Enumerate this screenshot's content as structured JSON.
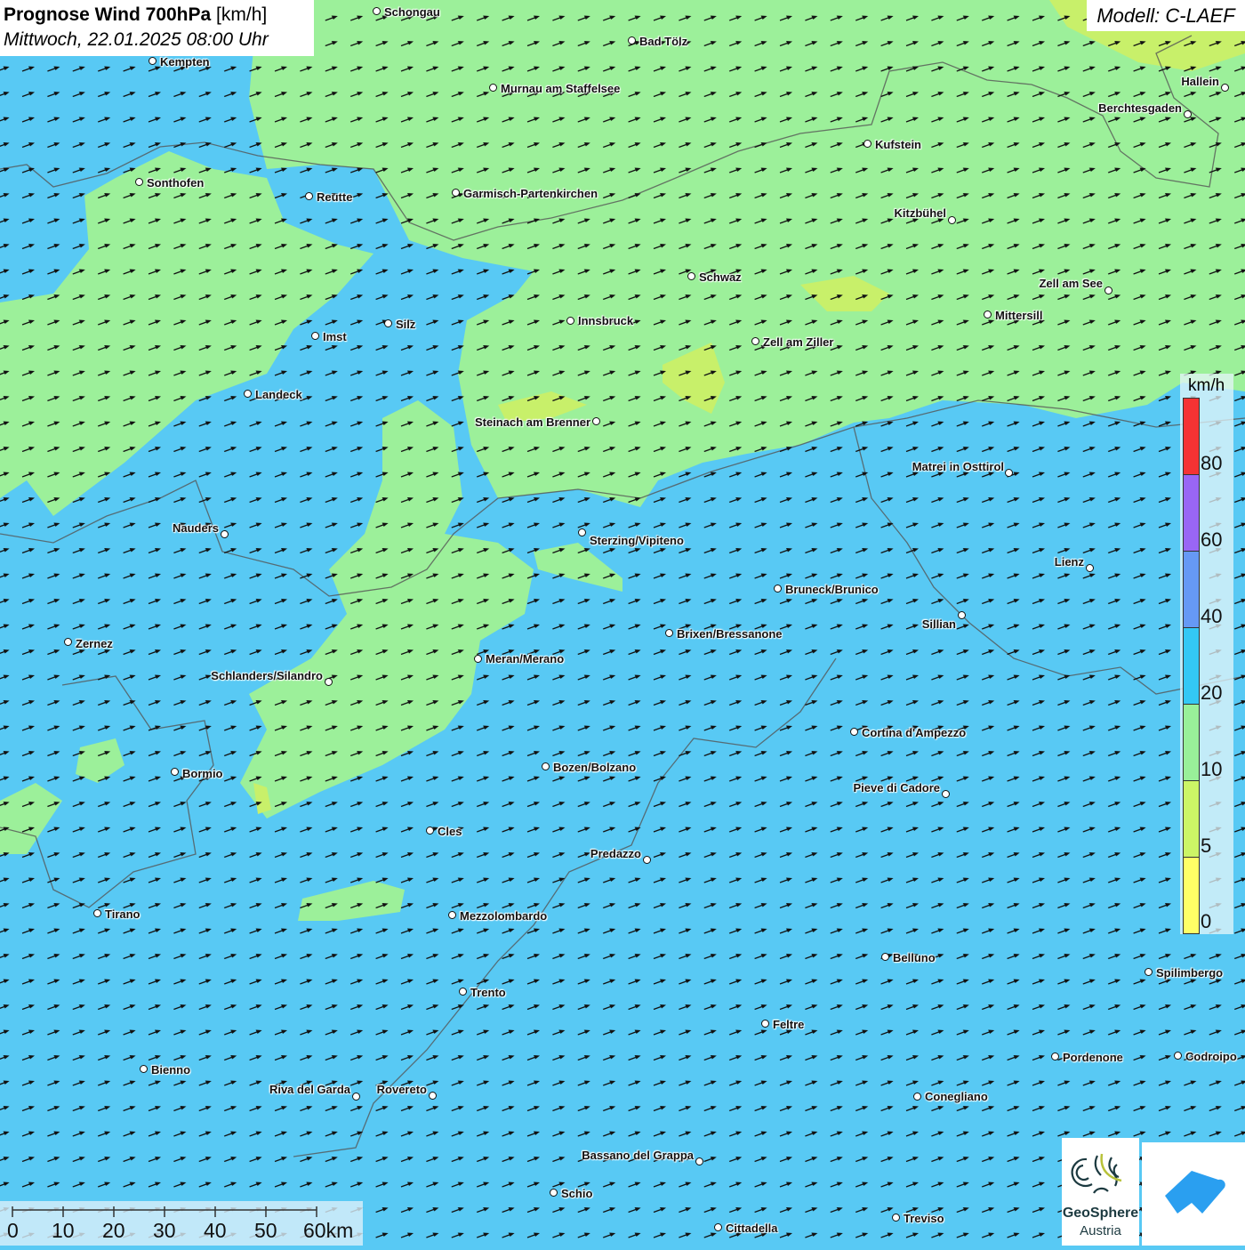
{
  "header": {
    "title_bold": "Prognose Wind 700hPa",
    "title_unit": "[km/h]",
    "subtitle": "Mittwoch, 22.01.2025 08:00 Uhr",
    "model": "Modell: C-LAEF"
  },
  "legend": {
    "unit": "km/h",
    "ticks": [
      "0",
      "5",
      "10",
      "20",
      "40",
      "60",
      "80"
    ],
    "colors": [
      "#ffff66",
      "#ccf566",
      "#99f099",
      "#33c8f5",
      "#6699f5",
      "#9966f5",
      "#f53333"
    ]
  },
  "scale_bar": {
    "labels": [
      "0",
      "10",
      "20",
      "30",
      "40",
      "50",
      "60km"
    ]
  },
  "logos": {
    "geosphere_name": "GeoSphere",
    "geosphere_sub": "Austria"
  },
  "colors": {
    "calm_blue": "#58c9f4",
    "green": "#9cf09a",
    "yellowgreen": "#c8f06a"
  },
  "cities": [
    "Schongau",
    "Bad Tölz",
    "Kempten",
    "Murnau am Staffelsee",
    "Hallein",
    "Berchtesgaden",
    "Kufstein",
    "Sonthofen",
    "Reutte",
    "Garmisch-Partenkirchen",
    "Kitzbühel",
    "Schwaz",
    "Zell am See",
    "Innsbruck",
    "Silz",
    "Mittersill",
    "Imst",
    "Zell am Ziller",
    "Landeck",
    "Steinach am Brenner",
    "Matrei in Osttirol",
    "Nauders",
    "Sterzing/Vipiteno",
    "Lienz",
    "Bruneck/Brunico",
    "Sillian",
    "Brixen/Bressanone",
    "Zernez",
    "Meran/Merano",
    "Schlanders/Silandro",
    "Cortina d'Ampezzo",
    "Bozen/Bolzano",
    "Bormio",
    "Pieve di Cadore",
    "Cles",
    "Predazzo",
    "Tirano",
    "Mezzolombardo",
    "Belluno",
    "Spilimbergo",
    "Trento",
    "Feltre",
    "Codroipo",
    "Pordenone",
    "Bienno",
    "Riva del Garda",
    "Rovereto",
    "Conegliano",
    "Bassano del Grappa",
    "Schio",
    "Treviso",
    "Cittadella"
  ]
}
